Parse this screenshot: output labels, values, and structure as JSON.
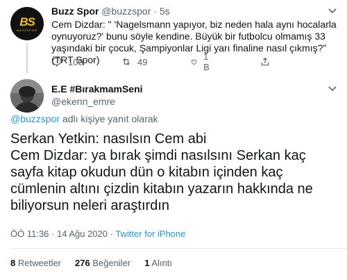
{
  "parent_tweet": {
    "avatar_text": "BS",
    "avatar_subtext": "BUZZSPOR",
    "name": "Buzz Spor",
    "handle": "@buzzspor",
    "separator": "·",
    "time": "5s",
    "text": "Cem Dizdar: \" 'Nagelsmann yapıyor, biz neden hala aynı hocalarla oynuyoruz?' bunu söyle kendine. Büyük bir futbolcu olmamış 33 yaşındaki bir çocuk, Şampiyonlar Ligi yarı finaline nasıl çıkmış?\" (TRT Spor)",
    "actions": {
      "reply_count": "100",
      "retweet_count": "49",
      "like_count": "1 B"
    }
  },
  "main_tweet": {
    "name": "E.E #BırakmamSeni",
    "handle": "@ekenn_emre",
    "reply_mention": "@buzzspor",
    "reply_suffix": " adlı kişiye yanıt olarak",
    "text_lines": [
      "Serkan Yetkin: nasılsın Cem abi",
      "Cem Dizdar: ya bırak şimdi nasılsını Serkan kaç sayfa kitap okudun dün o kitabın içinden kaç cümlenin altını çizdin  kitabın yazarın hakkında ne biliyorsun neleri araştırdın"
    ],
    "time": "ÖÖ 11:36",
    "date_sep": " · ",
    "date": "14 Ağu 2020",
    "source": "Twitter for iPhone",
    "stats": {
      "retweets_count": "8",
      "retweets_label": "Retweetler",
      "likes_count": "276",
      "likes_label": "Beğeniler",
      "quotes_count": "1",
      "quotes_label": "Alıntı"
    }
  },
  "colors": {
    "accent": "#1d9bf0",
    "text": "#0f1419",
    "secondary": "#536471",
    "bs_yellow": "#f5c400"
  },
  "icons": [
    "chevron-down-icon",
    "reply-icon",
    "retweet-icon",
    "like-icon",
    "share-icon"
  ]
}
